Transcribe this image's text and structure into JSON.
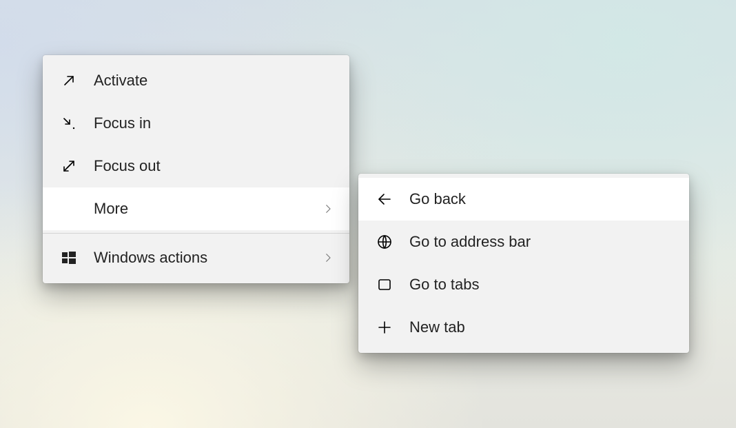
{
  "main_menu": {
    "items": [
      {
        "label": "Activate",
        "icon": "arrow-up-right-icon",
        "submenu": false
      },
      {
        "label": "Focus in",
        "icon": "arrow-in-icon",
        "submenu": false
      },
      {
        "label": "Focus out",
        "icon": "arrow-out-icon",
        "submenu": false
      },
      {
        "label": "More",
        "icon": "",
        "submenu": true,
        "hovered": true
      },
      {
        "label": "Windows actions",
        "icon": "windows-logo-icon",
        "submenu": true,
        "separator_before": true
      }
    ]
  },
  "sub_menu": {
    "items": [
      {
        "label": "Go back",
        "icon": "arrow-left-icon",
        "hovered": true
      },
      {
        "label": "Go to address bar",
        "icon": "globe-icon"
      },
      {
        "label": "Go to tabs",
        "icon": "tab-icon"
      },
      {
        "label": "New tab",
        "icon": "plus-icon"
      }
    ]
  }
}
